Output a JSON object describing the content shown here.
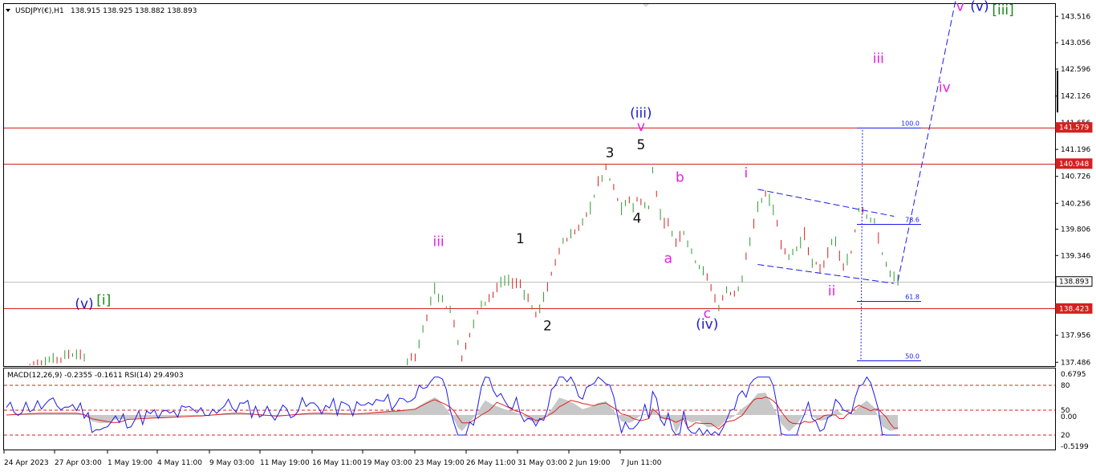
{
  "header": {
    "symbol_text": "USDJPY(€),H1",
    "ohlc_text": "138.915 138.925 138.882 138.893"
  },
  "indicator_header": "MACD(12,26,9) -0.2355 -0.1611  RSI(14) 29.4903",
  "chart_data": [
    {
      "type": "candlestick",
      "symbol": "USDJPY(€)",
      "timeframe": "H1",
      "last_ohlc": {
        "open": 138.915,
        "high": 138.925,
        "low": 138.882,
        "close": 138.893
      },
      "ylim": [
        137.42,
        143.73
      ],
      "price_ticks": [
        "143.516",
        "143.056",
        "142.596",
        "142.126",
        "141.656",
        "141.196",
        "140.726",
        "140.256",
        "139.806",
        "139.346",
        "138.886",
        "138.426",
        "137.956",
        "137.486"
      ],
      "x_ticks": [
        "24 Apr 2023",
        "27 Apr 03:00",
        "1 May 19:00",
        "4 May 11:00",
        "9 May 03:00",
        "11 May 19:00",
        "16 May 11:00",
        "19 May 03:00",
        "23 May 19:00",
        "26 May 11:00",
        "31 May 03:00",
        "2 Jun 19:00",
        "7 Jun 11:00"
      ],
      "bar_count": 270,
      "price_path": [
        [
          0,
          137.3
        ],
        [
          5,
          137.4
        ],
        [
          10,
          137.5
        ],
        [
          15,
          137.6
        ],
        [
          18,
          137.66
        ],
        [
          20,
          137.55
        ],
        [
          22,
          137.2
        ],
        [
          30,
          136.8
        ],
        [
          40,
          136.5
        ],
        [
          50,
          136.4
        ],
        [
          60,
          136.6
        ],
        [
          70,
          136.5
        ],
        [
          80,
          136.7
        ],
        [
          90,
          136.8
        ],
        [
          100,
          137.2
        ],
        [
          105,
          137.6
        ],
        [
          108,
          138.3
        ],
        [
          110,
          138.75
        ],
        [
          113,
          138.5
        ],
        [
          115,
          138.2
        ],
        [
          117,
          137.55
        ],
        [
          119,
          138.0
        ],
        [
          122,
          138.5
        ],
        [
          125,
          138.7
        ],
        [
          128,
          138.9
        ],
        [
          132,
          138.85
        ],
        [
          134,
          138.6
        ],
        [
          136,
          138.3
        ],
        [
          138,
          138.6
        ],
        [
          140,
          139.0
        ],
        [
          142,
          139.5
        ],
        [
          145,
          139.7
        ],
        [
          148,
          139.9
        ],
        [
          150,
          140.2
        ],
        [
          152,
          140.6
        ],
        [
          154,
          140.85
        ],
        [
          156,
          140.5
        ],
        [
          158,
          140.15
        ],
        [
          160,
          140.3
        ],
        [
          161,
          140.25
        ],
        [
          163,
          140.3
        ],
        [
          165,
          140.15
        ],
        [
          166,
          140.85
        ],
        [
          168,
          140.05
        ],
        [
          170,
          139.9
        ],
        [
          172,
          139.6
        ],
        [
          174,
          139.8
        ],
        [
          176,
          139.4
        ],
        [
          178,
          139.2
        ],
        [
          180,
          138.95
        ],
        [
          183,
          138.45
        ],
        [
          185,
          138.75
        ],
        [
          187,
          138.7
        ],
        [
          189,
          138.9
        ],
        [
          191,
          139.6
        ],
        [
          193,
          140.2
        ],
        [
          195,
          140.45
        ],
        [
          197,
          140.15
        ],
        [
          199,
          139.6
        ],
        [
          201,
          139.3
        ],
        [
          203,
          139.5
        ],
        [
          205,
          139.7
        ],
        [
          207,
          139.2
        ],
        [
          209,
          139.1
        ],
        [
          211,
          139.4
        ],
        [
          213,
          139.6
        ],
        [
          215,
          139.1
        ],
        [
          217,
          139.4
        ],
        [
          219,
          140.2
        ],
        [
          221,
          140.1
        ],
        [
          223,
          139.9
        ],
        [
          225,
          139.4
        ],
        [
          227,
          139.0
        ],
        [
          229,
          138.9
        ]
      ],
      "horizontal_levels": [
        141.579,
        140.948,
        138.893,
        138.423
      ],
      "level_labels": [
        "141.579",
        "140.948",
        "138.893",
        "138.423"
      ],
      "fibonacci": {
        "levels": [
          "100.0",
          "78.6",
          "61.8",
          "50.0"
        ],
        "prices": [
          141.579,
          139.895,
          138.55,
          137.52
        ]
      },
      "projection_path": [
        [
          229,
          138.9
        ],
        [
          244,
          143.85
        ]
      ],
      "channel_lines": [
        [
          [
            193,
            140.5
          ],
          [
            228,
            140.03
          ]
        ],
        [
          [
            193,
            139.19
          ],
          [
            228,
            138.86
          ]
        ]
      ],
      "wave_labels": [
        {
          "text": "(v)",
          "bar": 20,
          "price": 138.43,
          "color": "#1a1acc"
        },
        {
          "text": "[i]",
          "bar": 25,
          "price": 138.49,
          "color": "#1a8a1a"
        },
        {
          "text": "iii",
          "bar": 111,
          "price": 139.51,
          "color": "#e61ee6"
        },
        {
          "text": "1",
          "bar": 132,
          "price": 139.56,
          "color": "#111111"
        },
        {
          "text": "2",
          "bar": 139,
          "price": 138.04,
          "color": "#111111"
        },
        {
          "text": "3",
          "bar": 155,
          "price": 141.06,
          "color": "#111111"
        },
        {
          "text": "4",
          "bar": 162,
          "price": 139.92,
          "color": "#111111"
        },
        {
          "text": "5",
          "bar": 163,
          "price": 141.2,
          "color": "#111111"
        },
        {
          "text": "(iii)",
          "bar": 163,
          "price": 141.75,
          "color": "#1a1acc"
        },
        {
          "text": "v",
          "bar": 163,
          "price": 141.52,
          "color": "#e61ee6"
        },
        {
          "text": "b",
          "bar": 173,
          "price": 140.63,
          "color": "#e61ee6"
        },
        {
          "text": "a",
          "bar": 170,
          "price": 139.22,
          "color": "#e61ee6"
        },
        {
          "text": "c",
          "bar": 180,
          "price": 138.26,
          "color": "#e61ee6"
        },
        {
          "text": "(iv)",
          "bar": 180,
          "price": 138.07,
          "color": "#1a1acc"
        },
        {
          "text": "i",
          "bar": 190,
          "price": 140.71,
          "color": "#e61ee6"
        },
        {
          "text": "ii",
          "bar": 212,
          "price": 138.65,
          "color": "#e61ee6"
        },
        {
          "text": "iii",
          "bar": 224,
          "price": 142.7,
          "color": "#e61ee6"
        },
        {
          "text": "iv",
          "bar": 241,
          "price": 142.2,
          "color": "#e61ee6"
        },
        {
          "text": "v",
          "bar": 245,
          "price": 143.61,
          "color": "#e61ee6"
        },
        {
          "text": "(v)",
          "bar": 250,
          "price": 143.61,
          "color": "#1a1acc"
        },
        {
          "text": "[iii]",
          "bar": 256,
          "price": 143.55,
          "color": "#1a8a1a"
        }
      ]
    },
    {
      "type": "line",
      "name": "MACD(12,26,9) / RSI(14)",
      "values_text": "-0.2355 -0.1611  RSI(14) 29.4903",
      "ylim_labels": [
        "0.6795",
        "80",
        "50",
        "0.00",
        "20",
        "-0.5199"
      ],
      "rsi_levels": [
        80,
        50,
        20
      ]
    }
  ]
}
